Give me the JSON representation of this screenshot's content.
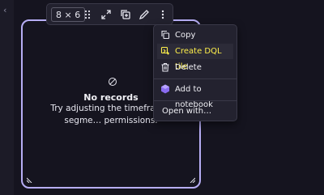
{
  "toolbar": {
    "size_label": "8 × 6",
    "icons": [
      "drag-handle-icon",
      "maximize-icon",
      "duplicate-icon",
      "edit-icon",
      "more-options-icon"
    ]
  },
  "tile": {
    "empty_title": "No records",
    "empty_desc": "Try adjusting the timeframe, segme… permissions."
  },
  "menu": {
    "items": [
      {
        "label": "Copy",
        "icon": "copy-icon"
      },
      {
        "label": "Create DQL tile",
        "icon": "dql-tile-icon",
        "highlighted": true
      },
      {
        "label": "Delete",
        "icon": "trash-icon"
      },
      {
        "label": "Add to notebook",
        "icon": "notebook-icon"
      },
      {
        "label": "Open with…",
        "icon": ""
      }
    ]
  },
  "colors": {
    "accent": "#b7aef5",
    "highlight_text": "#fff04a",
    "background": "#15141f"
  }
}
